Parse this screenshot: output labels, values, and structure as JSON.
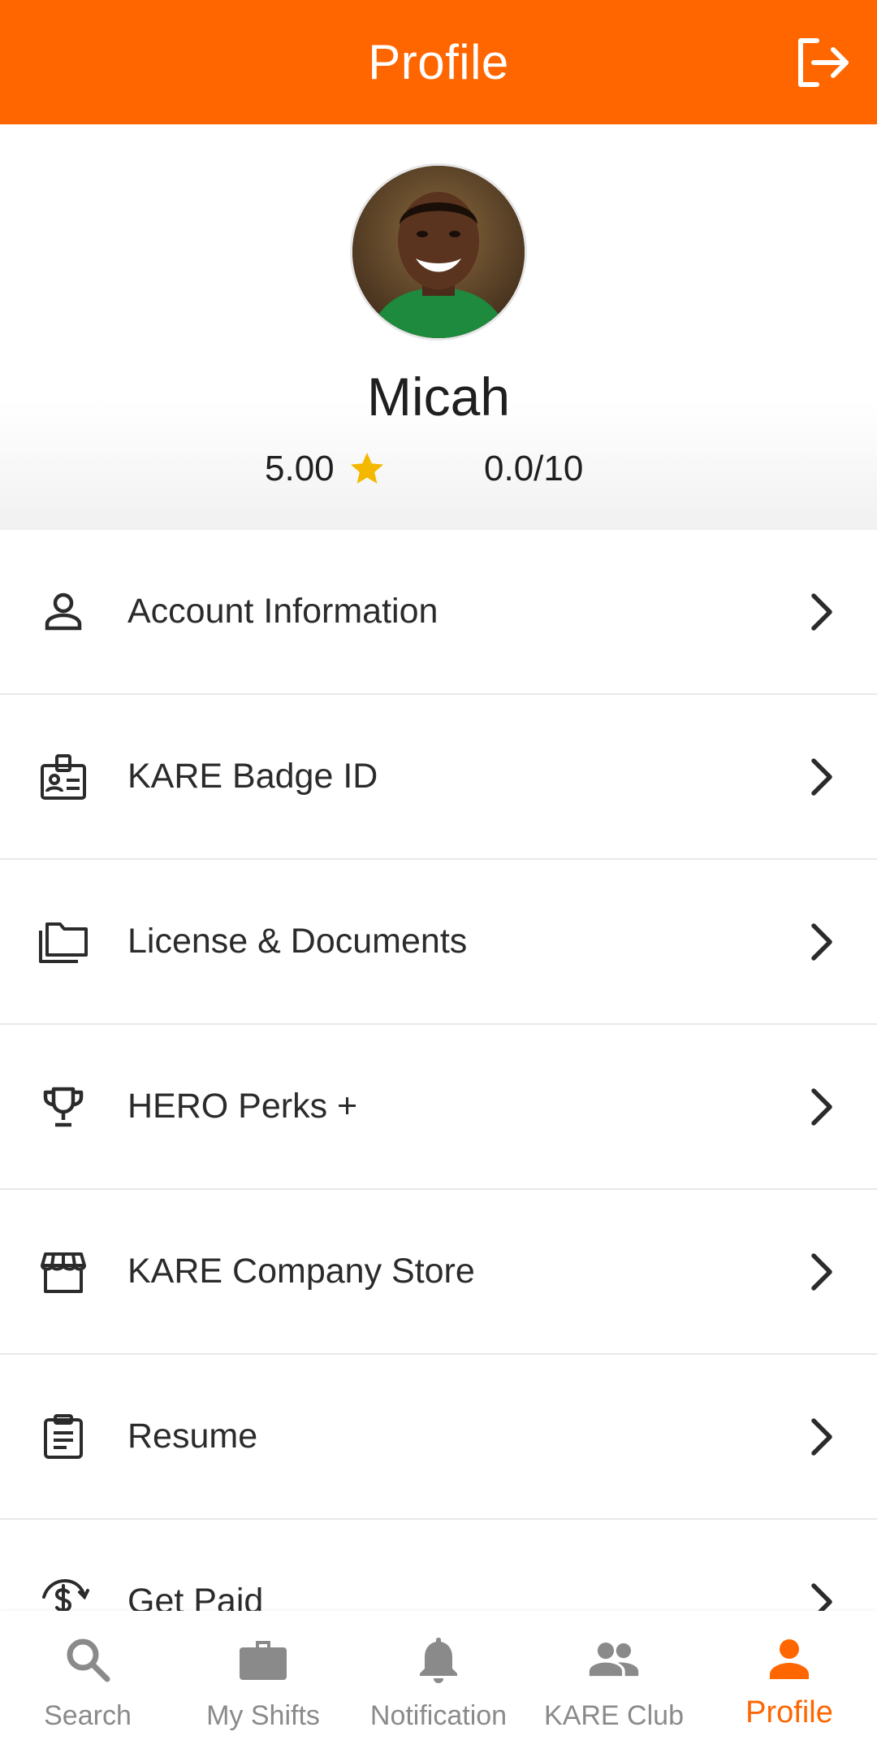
{
  "app_bar": {
    "title": "Profile"
  },
  "profile": {
    "name": "Micah",
    "rating": "5.00",
    "score": "0.0/10"
  },
  "menu": [
    {
      "label": "Account Information",
      "icon": "person-icon"
    },
    {
      "label": "KARE Badge ID",
      "icon": "badge-icon"
    },
    {
      "label": "License & Documents",
      "icon": "folders-icon"
    },
    {
      "label": "HERO Perks +",
      "icon": "trophy-icon"
    },
    {
      "label": "KARE Company Store",
      "icon": "store-icon"
    },
    {
      "label": "Resume",
      "icon": "clipboard-icon"
    },
    {
      "label": "Get Paid",
      "icon": "dollar-refresh-icon"
    }
  ],
  "bottom_nav": [
    {
      "label": "Search",
      "icon": "search-icon",
      "active": false
    },
    {
      "label": "My Shifts",
      "icon": "briefcase-icon",
      "active": false
    },
    {
      "label": "Notification",
      "icon": "bell-icon",
      "active": false
    },
    {
      "label": "KARE Club",
      "icon": "group-icon",
      "active": false
    },
    {
      "label": "Profile",
      "icon": "person-icon",
      "active": true
    }
  ],
  "colors": {
    "accent": "#ff6600",
    "star": "#f5b800",
    "nav_inactive": "#8a8a8a"
  }
}
